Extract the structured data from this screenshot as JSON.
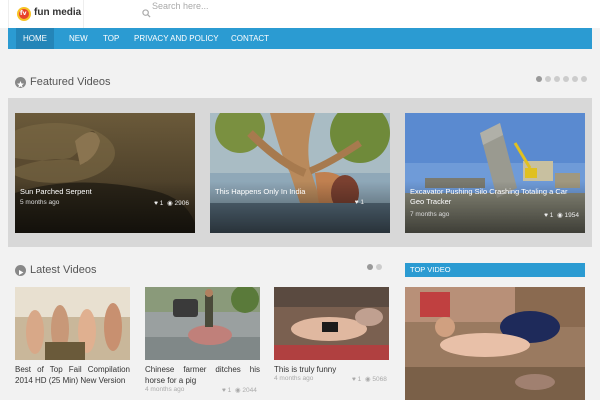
{
  "header": {
    "logo_badge": "fv",
    "logo_text": "fun media",
    "search_placeholder": "Search here...",
    "search_icon": "search-icon"
  },
  "nav": {
    "items": [
      {
        "label": "HOME",
        "active": true
      },
      {
        "label": "NEW"
      },
      {
        "label": "TOP"
      },
      {
        "label": "PRIVACY AND POLICY"
      },
      {
        "label": "CONTACT"
      }
    ]
  },
  "featured": {
    "title": "Featured Videos",
    "icon": "star-icon",
    "dot_count": 6,
    "videos": [
      {
        "title": "Sun Parched Serpent",
        "meta": "5 months ago",
        "likes": "1",
        "views": "2906"
      },
      {
        "title": "This Happens Only In India",
        "meta": "",
        "likes": "1",
        "views": ""
      },
      {
        "title": "Excavator Pushing Silo Crashing Totaling a Car Geo Tracker",
        "meta": "7 months ago",
        "likes": "1",
        "views": "1954"
      }
    ]
  },
  "latest": {
    "title": "Latest Videos",
    "icon": "play-icon",
    "dot_count": 2,
    "videos": [
      {
        "title": "Best of Top Fail Compilation 2014 HD (25 Min) New Version",
        "meta": "",
        "likes": "",
        "views": ""
      },
      {
        "title": "Chinese farmer ditches his horse for a pig",
        "meta": "4 months ago",
        "likes": "1",
        "views": "2044"
      },
      {
        "title": "This is truly funny",
        "meta": "4 months ago",
        "likes": "1",
        "views": "5068"
      }
    ]
  },
  "sidebar": {
    "top_video_label": "TOP VIDEO"
  },
  "colors": {
    "accent": "#2b9bd2",
    "nav_active": "#2485b8",
    "background": "#f2f2f2"
  }
}
